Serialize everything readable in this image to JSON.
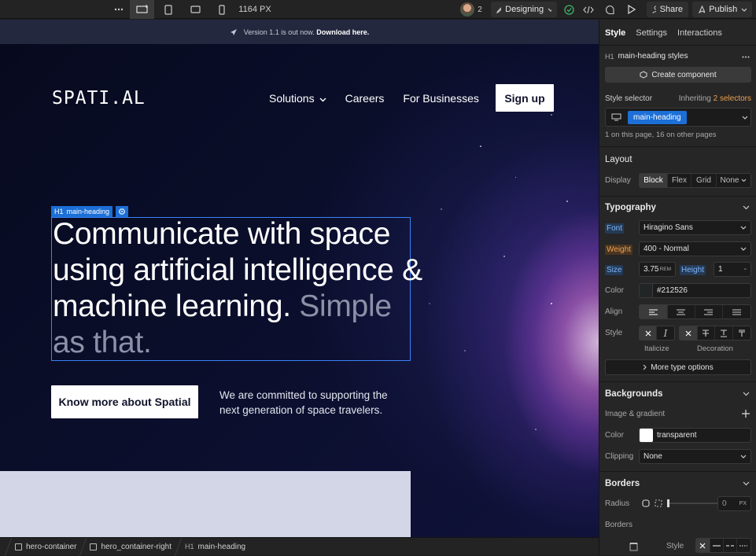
{
  "topbar": {
    "more_icon": "ellipsis-icon",
    "viewport_width": "1164 PX",
    "collaborator_count": "2",
    "mode_label": "Designing",
    "share_label": "Share",
    "publish_label": "Publish"
  },
  "canvas": {
    "banner": {
      "text": "Version 1.1 is out now.",
      "link": "Download here."
    },
    "logo": "SPATI.AL",
    "nav": {
      "solutions": "Solutions",
      "careers": "Careers",
      "business": "For Businesses",
      "signup": "Sign up"
    },
    "selection": {
      "tag": "H1",
      "name": "main-heading"
    },
    "heading": {
      "main": "Communicate with space using artificial intelligence & machine learning.",
      "dim": "Simple as that."
    },
    "cta": "Know more about Spatial",
    "description": "We are committed to supporting the next generation of space travelers."
  },
  "breadcrumbs": [
    {
      "label": "hero-container",
      "tag": ""
    },
    {
      "label": "hero_container-right",
      "tag": ""
    },
    {
      "label": "main-heading",
      "tag": "H1"
    }
  ],
  "panel": {
    "tabs": {
      "style": "Style",
      "settings": "Settings",
      "interactions": "Interactions"
    },
    "element_tag": "H1",
    "element_styles": "main-heading styles",
    "create_component": "Create component",
    "style_selector": "Style selector",
    "inheriting": "Inheriting",
    "inheriting_count": "2 selectors",
    "selector_chip": "main-heading",
    "usage": "1 on this page, 16 on other pages",
    "layout": {
      "title": "Layout",
      "display_label": "Display",
      "options": [
        "Block",
        "Flex",
        "Grid",
        "None"
      ],
      "active": "Block"
    },
    "typography": {
      "title": "Typography",
      "font_label": "Font",
      "font_value": "Hiragino Sans",
      "weight_label": "Weight",
      "weight_value": "400 - Normal",
      "size_label": "Size",
      "size_value": "3.75",
      "size_unit": "REM",
      "height_label": "Height",
      "height_value": "1",
      "height_unit": "-",
      "color_label": "Color",
      "color_value": "#212526",
      "align_label": "Align",
      "style_label": "Style",
      "italicize_label": "Italicize",
      "decoration_label": "Decoration",
      "more_label": "More type options"
    },
    "backgrounds": {
      "title": "Backgrounds",
      "image_label": "Image & gradient",
      "color_label": "Color",
      "color_value": "transparent",
      "clipping_label": "Clipping",
      "clipping_value": "None"
    },
    "borders": {
      "title": "Borders",
      "radius_label": "Radius",
      "radius_value": "0",
      "radius_unit": "PX",
      "borders_label": "Borders",
      "style_label": "Style"
    }
  }
}
